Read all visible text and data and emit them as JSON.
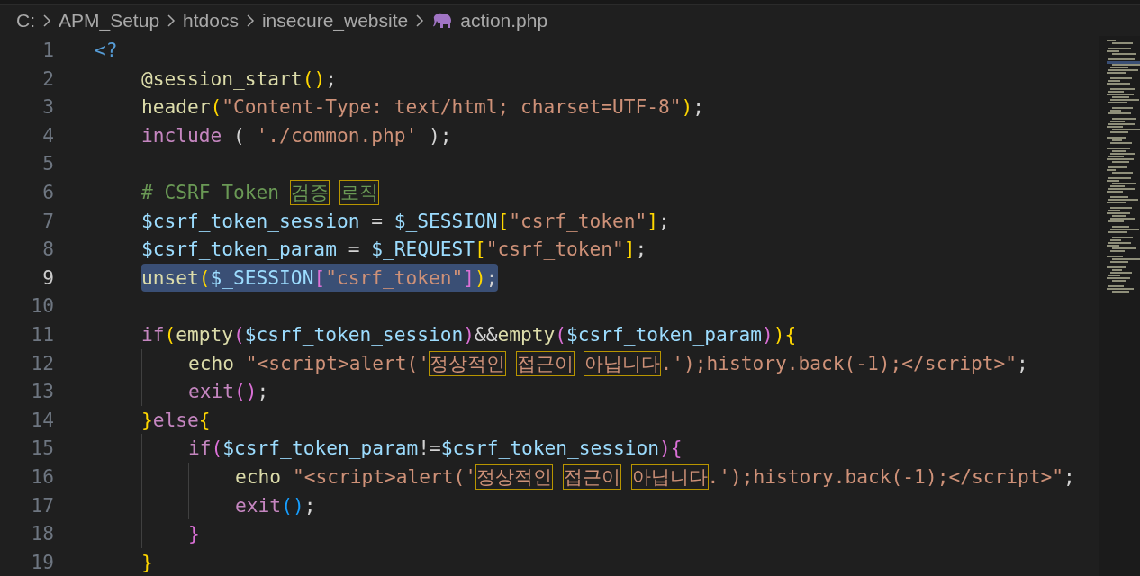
{
  "breadcrumb": [
    {
      "label": "C:",
      "kind": "folder"
    },
    {
      "label": "APM_Setup",
      "kind": "folder"
    },
    {
      "label": "htdocs",
      "kind": "folder"
    },
    {
      "label": "insecure_website",
      "kind": "folder"
    },
    {
      "label": "action.php",
      "kind": "php-file"
    }
  ],
  "lines": [
    {
      "number": "1",
      "selected": false,
      "code": [
        {
          "text": "<?",
          "kind": "tag"
        }
      ]
    },
    {
      "number": "2",
      "selected": false,
      "code": [
        {
          "text": "    @session_start",
          "kind": "fn"
        },
        {
          "text": "()",
          "kind": "br1"
        },
        {
          "text": ";",
          "kind": "punc"
        }
      ]
    },
    {
      "number": "3",
      "selected": false,
      "code": [
        {
          "text": "    header",
          "kind": "fn"
        },
        {
          "text": "(",
          "kind": "br1"
        },
        {
          "text": "\"Content-Type: text/html; charset=UTF-8\"",
          "kind": "str"
        },
        {
          "text": ")",
          "kind": "br1"
        },
        {
          "text": ";",
          "kind": "punc"
        }
      ]
    },
    {
      "number": "4",
      "selected": false,
      "code": [
        {
          "text": "    include",
          "kind": "kw"
        },
        {
          "text": " ( ",
          "kind": "punc"
        },
        {
          "text": "'./common.php'",
          "kind": "str"
        },
        {
          "text": " );",
          "kind": "punc"
        }
      ]
    },
    {
      "number": "5",
      "selected": false
    },
    {
      "number": "6",
      "selected": false,
      "code": [
        {
          "text": "    # CSRF Token ",
          "kind": "cmt"
        },
        {
          "text": "검증",
          "kind": "cmt-boxed"
        },
        {
          "text": " 로직",
          "kind": "cmt-boxed"
        }
      ]
    },
    {
      "number": "7",
      "selected": false,
      "code": [
        {
          "text": "    $csrf_token_session",
          "kind": "var"
        },
        {
          "text": " = ",
          "kind": "punc"
        },
        {
          "text": "$_SESSION",
          "kind": "var"
        },
        {
          "text": "[",
          "kind": "br1"
        },
        {
          "text": "\"csrf_token\"",
          "kind": "str"
        },
        {
          "text": "]",
          "kind": "br1"
        },
        {
          "text": ";",
          "kind": "punc"
        }
      ]
    },
    {
      "number": "8",
      "selected": false,
      "code": [
        {
          "text": "    $csrf_token_param",
          "kind": "var"
        },
        {
          "text": " = ",
          "kind": "punc"
        },
        {
          "text": "$_REQUEST",
          "kind": "var"
        },
        {
          "text": "[",
          "kind": "br1"
        },
        {
          "text": "\"csrf_token\"",
          "kind": "str"
        },
        {
          "text": "]",
          "kind": "br1"
        },
        {
          "text": ";",
          "kind": "punc"
        }
      ]
    },
    {
      "number": "9",
      "selected": true,
      "code": [
        {
          "text": "    unset",
          "kind": "fn"
        },
        {
          "text": "(",
          "kind": "br1"
        },
        {
          "text": "$_SESSION",
          "kind": "var"
        },
        {
          "text": "[",
          "kind": "br2"
        },
        {
          "text": "\"csrf_token\"",
          "kind": "str"
        },
        {
          "text": "]",
          "kind": "br2"
        },
        {
          "text": ")",
          "kind": "br1"
        },
        {
          "text": ";",
          "kind": "punc"
        }
      ]
    },
    {
      "number": "10",
      "selected": false
    },
    {
      "number": "11",
      "selected": false,
      "code": [
        {
          "text": "    if",
          "kind": "kw"
        },
        {
          "text": "(",
          "kind": "br1"
        },
        {
          "text": "empty",
          "kind": "fn"
        },
        {
          "text": "(",
          "kind": "br2"
        },
        {
          "text": "$csrf_token_session",
          "kind": "var"
        },
        {
          "text": ")",
          "kind": "br2"
        },
        {
          "text": "&&",
          "kind": "punc"
        },
        {
          "text": "empty",
          "kind": "fn"
        },
        {
          "text": "(",
          "kind": "br2"
        },
        {
          "text": "$csrf_token_param",
          "kind": "var"
        },
        {
          "text": ")",
          "kind": "br2"
        },
        {
          "text": ")",
          "kind": "br1"
        },
        {
          "text": "{",
          "kind": "br1"
        }
      ]
    },
    {
      "number": "12",
      "selected": false,
      "code": [
        {
          "text": "        echo ",
          "kind": "fn"
        },
        {
          "text": "\"<script>alert('",
          "kind": "str"
        },
        {
          "text": "정상적인",
          "kind": "str-boxed"
        },
        {
          "text": " 접근이",
          "kind": "str-boxed"
        },
        {
          "text": " 아닙니다",
          "kind": "str-boxed"
        },
        {
          "text": ".');history.back(-1);</script>\"",
          "kind": "str"
        },
        {
          "text": ";",
          "kind": "punc"
        }
      ]
    },
    {
      "number": "13",
      "selected": false,
      "code": [
        {
          "text": "        exit",
          "kind": "kw"
        },
        {
          "text": "()",
          "kind": "br2"
        },
        {
          "text": ";",
          "kind": "punc"
        }
      ]
    },
    {
      "number": "14",
      "selected": false,
      "code": [
        {
          "text": "    }",
          "kind": "br1"
        },
        {
          "text": "else",
          "kind": "kw"
        },
        {
          "text": "{",
          "kind": "br1"
        }
      ]
    },
    {
      "number": "15",
      "selected": false,
      "code": [
        {
          "text": "        if",
          "kind": "kw"
        },
        {
          "text": "(",
          "kind": "br2"
        },
        {
          "text": "$csrf_token_param",
          "kind": "var"
        },
        {
          "text": "!=",
          "kind": "punc"
        },
        {
          "text": "$csrf_token_session",
          "kind": "var"
        },
        {
          "text": ")",
          "kind": "br2"
        },
        {
          "text": "{",
          "kind": "br2"
        }
      ]
    },
    {
      "number": "16",
      "selected": false,
      "code": [
        {
          "text": "            echo ",
          "kind": "fn"
        },
        {
          "text": "\"<script>alert('",
          "kind": "str"
        },
        {
          "text": "정상적인",
          "kind": "str-boxed"
        },
        {
          "text": " 접근이",
          "kind": "str-boxed"
        },
        {
          "text": " 아닙니다",
          "kind": "str-boxed"
        },
        {
          "text": ".');history.back(-1);</script>\"",
          "kind": "str"
        },
        {
          "text": ";",
          "kind": "punc"
        }
      ]
    },
    {
      "number": "17",
      "selected": false,
      "code": [
        {
          "text": "            exit",
          "kind": "kw"
        },
        {
          "text": "()",
          "kind": "br3"
        },
        {
          "text": ";",
          "kind": "punc"
        }
      ]
    },
    {
      "number": "18",
      "selected": false,
      "code": [
        {
          "text": "        }",
          "kind": "br2"
        }
      ]
    },
    {
      "number": "19",
      "selected": false,
      "code": [
        {
          "text": "    }",
          "kind": "br1"
        }
      ]
    }
  ]
}
